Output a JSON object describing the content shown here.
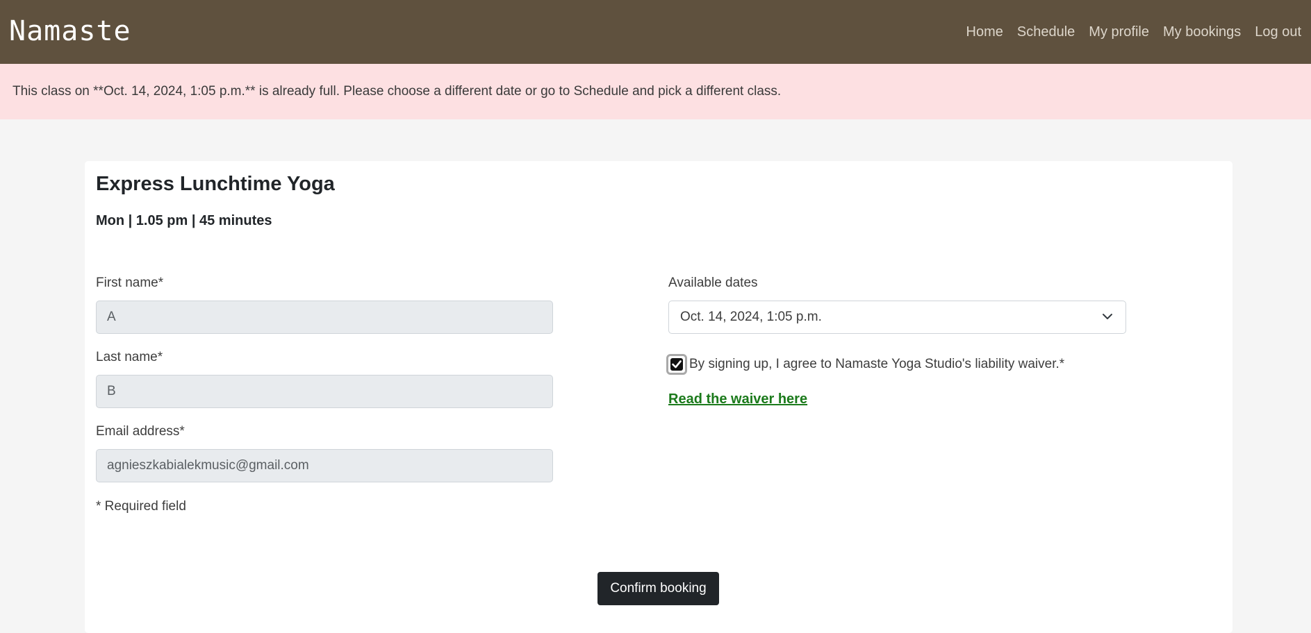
{
  "nav": {
    "brand": "Namaste",
    "links": [
      "Home",
      "Schedule",
      "My profile",
      "My bookings",
      "Log out"
    ]
  },
  "alert": {
    "message": "This class on **Oct. 14, 2024, 1:05 p.m.** is already full. Please choose a different date or go to Schedule and pick a different class."
  },
  "class_info": {
    "title": "Express Lunchtime Yoga",
    "meta": "Mon | 1.05 pm | 45 minutes"
  },
  "form": {
    "first_name_label": "First name*",
    "first_name_value": "A",
    "last_name_label": "Last name*",
    "last_name_value": "B",
    "email_label": "Email address*",
    "email_value": "agnieszkabialekmusic@gmail.com",
    "required_note": "* Required field",
    "dates_label": "Available dates",
    "dates_selected": "Oct. 14, 2024, 1:05 p.m.",
    "waiver_checkbox_label": "By signing up, I agree to Namaste Yoga Studio's liability waiver.*",
    "waiver_checked": true,
    "waiver_link": "Read the waiver here",
    "submit_label": "Confirm booking"
  },
  "colors": {
    "navbar": "#5f513e",
    "alert_bg": "#fde0e2",
    "link_green": "#1b7a1b",
    "button_dark": "#212529"
  }
}
